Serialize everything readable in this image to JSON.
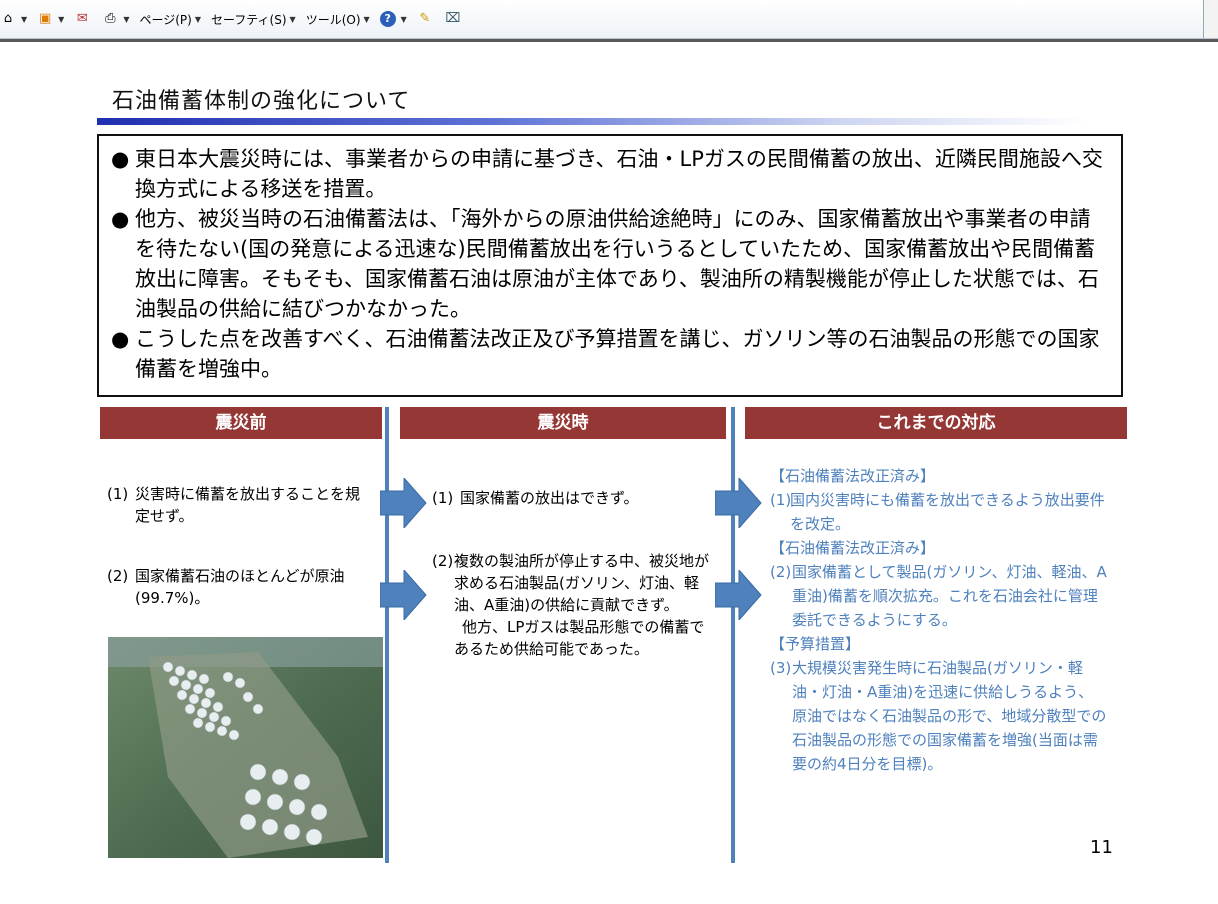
{
  "toolbar": {
    "page_label": "ページ(P)",
    "safety_label": "セーフティ(S)",
    "tools_label": "ツール(O)"
  },
  "slide": {
    "title": "石油備蓄体制の強化について",
    "bullets": [
      {
        "symbol": "●",
        "text": "東日本大震災時には、事業者からの申請に基づき、石油・LPガスの民間備蓄の放出、近隣民間施設へ交換方式による移送を措置。"
      },
      {
        "symbol": "●",
        "text": "他方、被災当時の石油備蓄法は、「海外からの原油供給途絶時」にのみ、国家備蓄放出や事業者の申請を待たない(国の発意による迅速な)民間備蓄放出を行いうるとしていたため、国家備蓄放出や民間備蓄放出に障害。そもそも、国家備蓄石油は原油が主体であり、製油所の精製機能が停止した状態では、石油製品の供給に結びつかなかった。"
      },
      {
        "symbol": "●",
        "text": "こうした点を改善すべく、石油備蓄法改正及び予算措置を講じ、ガソリン等の石油製品の形態での国家備蓄を増強中。"
      }
    ],
    "columns": {
      "before": "震災前",
      "during": "震災時",
      "response": "これまでの対応"
    },
    "before_items": [
      {
        "num": "(1)",
        "text": "災害時に備蓄を放出することを規定せず。"
      },
      {
        "num": "(2)",
        "text": "国家備蓄石油のほとんどが原油(99.7%)。"
      }
    ],
    "during_items": [
      {
        "num": "(1)",
        "text": "国家備蓄の放出はできず。"
      },
      {
        "num": "(2)",
        "text": "複数の製油所が停止する中、被災地が求める石油製品(ガソリン、灯油、軽油、A重油)の供給に貢献できず。"
      },
      {
        "text": "他方、LPガスは製品形態での備蓄であるため供給可能であった。"
      }
    ],
    "response_items": [
      {
        "head": "【石油備蓄法改正済み】",
        "num": "(1)",
        "text": "国内災害時にも備蓄を放出できるよう放出要件を改定。"
      },
      {
        "head": "【石油備蓄法改正済み】",
        "num": "(2)",
        "text": "国家備蓄として製品(ガソリン、灯油、軽油、A重油)備蓄を順次拡充。これを石油会社に管理委託できるようにする。"
      },
      {
        "head": "【予算措置】",
        "num": "(3)",
        "text": "大規模災害発生時に石油製品(ガソリン・軽油・灯油・A重油)を迅速に供給しうるよう、原油ではなく石油製品の形で、地域分散型での石油製品の形態での国家備蓄を増強(当面は需要の約4日分を目標)。"
      }
    ],
    "page_number": "11"
  },
  "colors": {
    "header_red": "#953735",
    "accent_blue": "#4f81bd",
    "title_bar": "#1f2fb0"
  }
}
